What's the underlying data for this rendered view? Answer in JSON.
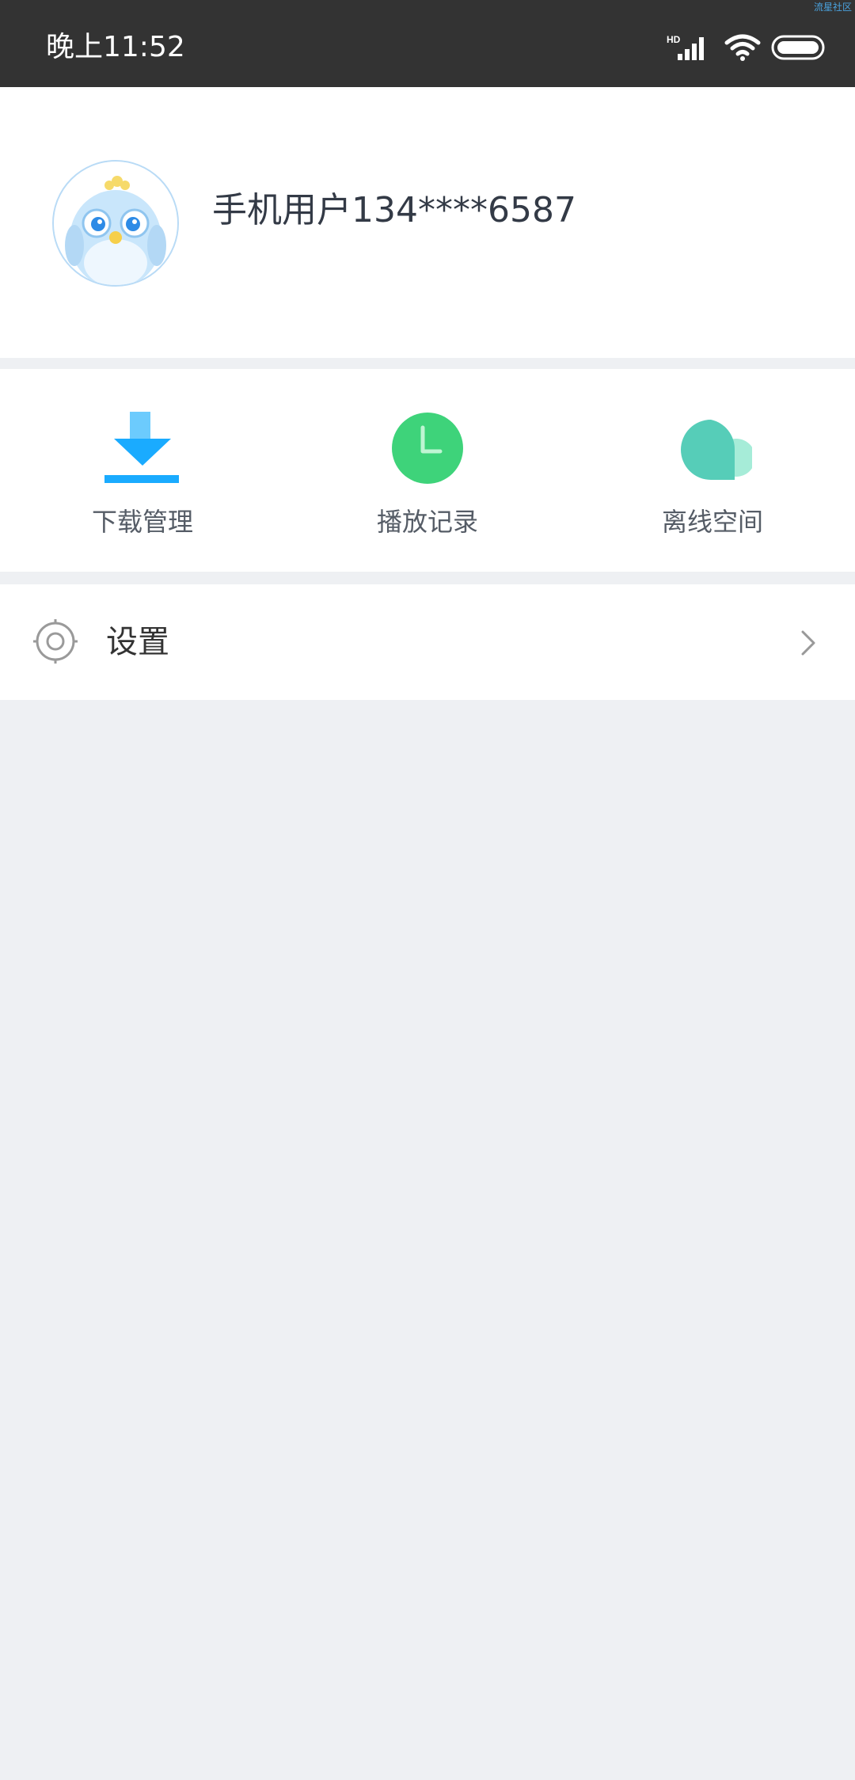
{
  "status_bar": {
    "time": "晚上11:52",
    "watermark": "流星社区",
    "signal_label": "HD",
    "icons": [
      "signal-icon",
      "wifi-icon",
      "battery-icon"
    ]
  },
  "profile": {
    "username": "手机用户134****6587",
    "avatar": "bird-avatar"
  },
  "quick_actions": [
    {
      "label": "下载管理",
      "icon": "download-icon",
      "color": "#1aabff"
    },
    {
      "label": "播放记录",
      "icon": "clock-icon",
      "color": "#3ed37a"
    },
    {
      "label": "离线空间",
      "icon": "cloud-icon",
      "color": "#56cdb8"
    }
  ],
  "settings": {
    "label": "设置",
    "icon": "gear-icon",
    "chevron": "chevron-right-icon"
  },
  "colors": {
    "status_bar_bg": "#333333",
    "page_bg": "#eef0f3",
    "card_bg": "#ffffff"
  }
}
